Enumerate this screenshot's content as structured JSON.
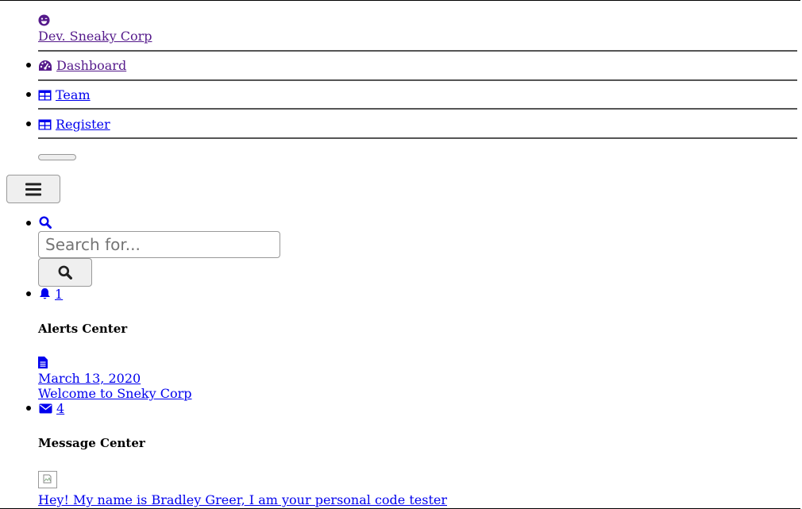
{
  "brand": {
    "icon": "laugh-wink-icon",
    "name": "Dev. Sneaky Corp"
  },
  "nav": {
    "items": [
      {
        "label": "Dashboard",
        "icon": "tachometer-icon"
      },
      {
        "label": "Team",
        "icon": "table-icon"
      },
      {
        "label": "Register",
        "icon": "table-icon"
      }
    ]
  },
  "topbar": {
    "search": {
      "placeholder": "Search for..."
    },
    "alerts": {
      "count": "1",
      "header": "Alerts Center",
      "items": [
        {
          "date": "March 13, 2020",
          "text": "Welcome to Sneky Corp",
          "icon": "file-alt-icon"
        }
      ]
    },
    "messages": {
      "count": "4",
      "header": "Message Center",
      "items": [
        {
          "text": "Hey! My name is Bradley Greer, I am your personal code tester",
          "icon": "broken-image-icon"
        }
      ]
    }
  },
  "colors": {
    "link": "#0000ee",
    "visited_link": "#551a8b"
  }
}
